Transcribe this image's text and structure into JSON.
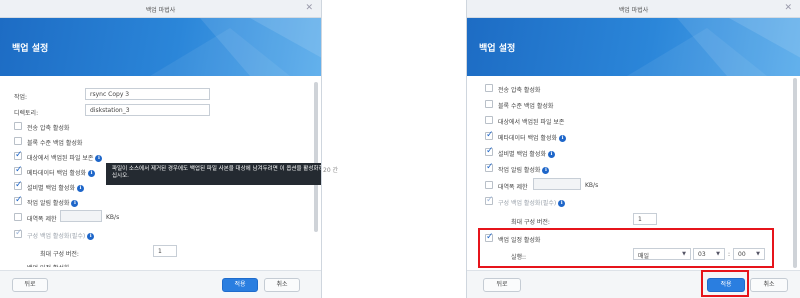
{
  "left": {
    "title": "백업 마법사",
    "heading": "백업 설정",
    "task_label": "작업:",
    "task_value": "rsync Copy 3",
    "dir_label": "디렉토리:",
    "dir_value": "diskstation_3",
    "opt_compress": "전송 압축 활성화",
    "opt_block": "블록 수준 백업 활성화",
    "opt_keep_deleted": "대상에서 백업된 파일 보존",
    "opt_metadata": "메타데이터 백업 활성화",
    "opt_integrity": "설비별 백업 활성화",
    "opt_notify": "작업 알림 활성화",
    "opt_bandwidth": "대역폭 제한",
    "bandwidth_unit": "KB/s",
    "opt_versioning": "구성 백업 활성화(필수)",
    "max_versions_label": "최대 구성 버전:",
    "max_versions_value": "1",
    "cut_off_label": "백업 일정 활성화",
    "tooltip": "파일이 소스에서 제거된 경우에도 백업된 파일 사본을 대상에 남겨두려면 이 옵션을 활성화하십시오.",
    "back_button": "뒤로",
    "apply_button": "적용",
    "cancel_button": "취소"
  },
  "stray_text": "20 간",
  "right": {
    "title": "백업 마법사",
    "heading": "백업 설정",
    "opt_compress": "전송 압축 활성화",
    "opt_block": "블록 수준 백업 활성화",
    "opt_keep_deleted": "대상에서 백업된 파일 보존",
    "opt_metadata": "메타데이터 백업 활성화",
    "opt_integrity": "설비별 백업 활성화",
    "opt_notify": "작업 알림 활성화",
    "opt_bandwidth": "대역폭 제한",
    "bandwidth_unit": "KB/s",
    "opt_versioning": "구성 백업 활성화(필수)",
    "max_versions_label": "최대 구성 버전:",
    "max_versions_value": "1",
    "opt_schedule": "백업 일정 활성화",
    "run_label": "실행::",
    "freq_value": "매일",
    "hour_value": "03",
    "minute_value": "00",
    "back_button": "뒤로",
    "apply_button": "적용",
    "cancel_button": "취소"
  },
  "colors": {
    "accent": "#2a7ee0",
    "highlight": "#e6141b",
    "banner": "#1d6cc4"
  }
}
